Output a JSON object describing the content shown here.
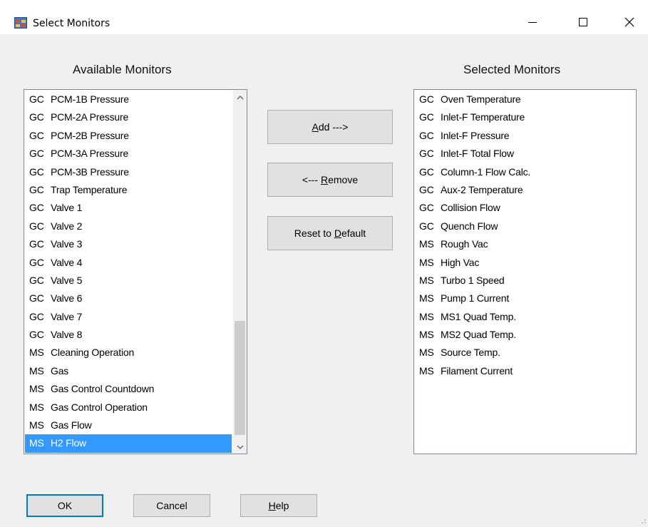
{
  "window": {
    "title": "Select Monitors",
    "icon": "app-window-icon",
    "controls": [
      "minimize-icon",
      "maximize-icon",
      "close-icon"
    ]
  },
  "available": {
    "heading": "Available Monitors",
    "items": [
      {
        "source": "GC",
        "name": "PCM-1B Pressure"
      },
      {
        "source": "GC",
        "name": "PCM-2A Pressure"
      },
      {
        "source": "GC",
        "name": "PCM-2B Pressure"
      },
      {
        "source": "GC",
        "name": "PCM-3A Pressure"
      },
      {
        "source": "GC",
        "name": "PCM-3B Pressure"
      },
      {
        "source": "GC",
        "name": "Trap Temperature"
      },
      {
        "source": "GC",
        "name": "Valve 1"
      },
      {
        "source": "GC",
        "name": "Valve 2"
      },
      {
        "source": "GC",
        "name": "Valve 3"
      },
      {
        "source": "GC",
        "name": "Valve 4"
      },
      {
        "source": "GC",
        "name": "Valve 5"
      },
      {
        "source": "GC",
        "name": "Valve 6"
      },
      {
        "source": "GC",
        "name": "Valve 7"
      },
      {
        "source": "GC",
        "name": "Valve 8"
      },
      {
        "source": "MS",
        "name": "Cleaning Operation"
      },
      {
        "source": "MS",
        "name": "Gas"
      },
      {
        "source": "MS",
        "name": "Gas Control Countdown"
      },
      {
        "source": "MS",
        "name": "Gas Control Operation"
      },
      {
        "source": "MS",
        "name": "Gas Flow"
      },
      {
        "source": "MS",
        "name": "H2 Flow"
      }
    ],
    "selected_index": 19,
    "selection_color": "#3399ff"
  },
  "selected": {
    "heading": "Selected Monitors",
    "items": [
      {
        "source": "GC",
        "name": "Oven Temperature"
      },
      {
        "source": "GC",
        "name": "Inlet-F Temperature"
      },
      {
        "source": "GC",
        "name": "Inlet-F Pressure"
      },
      {
        "source": "GC",
        "name": "Inlet-F Total Flow"
      },
      {
        "source": "GC",
        "name": "Column-1 Flow Calc."
      },
      {
        "source": "GC",
        "name": "Aux-2 Temperature"
      },
      {
        "source": "GC",
        "name": "Collision Flow"
      },
      {
        "source": "GC",
        "name": "Quench Flow"
      },
      {
        "source": "MS",
        "name": "Rough Vac"
      },
      {
        "source": "MS",
        "name": "High Vac"
      },
      {
        "source": "MS",
        "name": "Turbo 1 Speed"
      },
      {
        "source": "MS",
        "name": "Pump 1 Current"
      },
      {
        "source": "MS",
        "name": "MS1 Quad Temp."
      },
      {
        "source": "MS",
        "name": "MS2 Quad Temp."
      },
      {
        "source": "MS",
        "name": "Source Temp."
      },
      {
        "source": "MS",
        "name": "Filament Current"
      }
    ]
  },
  "buttons": {
    "add": {
      "mnemonic": "A",
      "rest": "dd --->"
    },
    "remove": {
      "prefix": "<--- ",
      "mnemonic": "R",
      "rest": "emove"
    },
    "reset": {
      "prefix": "Reset to ",
      "mnemonic": "D",
      "rest": "efault"
    },
    "ok": "OK",
    "cancel": "Cancel",
    "help": {
      "mnemonic": "H",
      "rest": "elp"
    }
  },
  "colors": {
    "accent": "#0078d7",
    "dialog_background": "#f0f0f0"
  }
}
